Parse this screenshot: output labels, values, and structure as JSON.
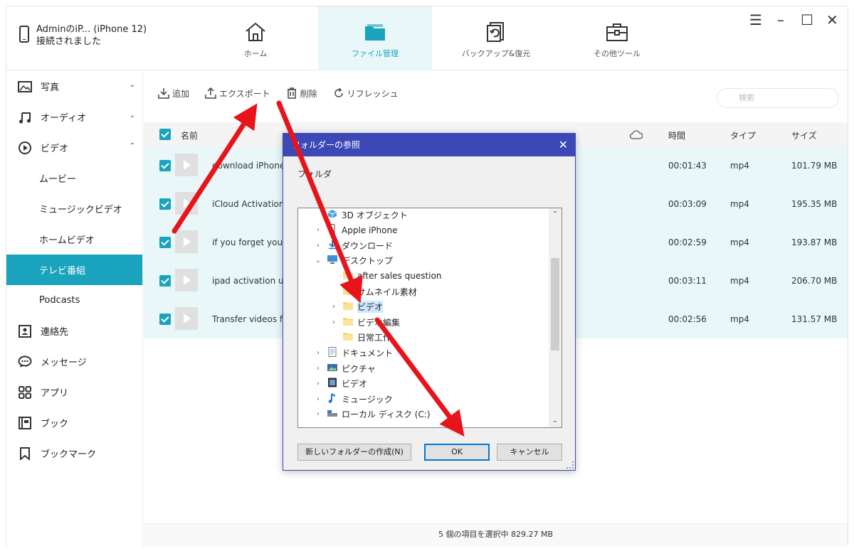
{
  "device": {
    "name": "AdminのiP... (iPhone 12)",
    "status": "接続されました"
  },
  "nav": [
    {
      "label": "ホーム",
      "icon": "home-icon"
    },
    {
      "label": "ファイル管理",
      "icon": "folder-icon",
      "active": true
    },
    {
      "label": "バックアップ&復元",
      "icon": "backup-restore-icon"
    },
    {
      "label": "その他ツール",
      "icon": "toolbox-icon"
    }
  ],
  "window_controls": {
    "menu": "☰",
    "minimize": "–",
    "maximize": "☐",
    "close": "✕"
  },
  "sidebar": {
    "photos": "写真",
    "audio": "オーディオ",
    "video": "ビデオ",
    "video_sub": [
      "ムービー",
      "ミュージックビデオ",
      "ホームビデオ",
      "テレビ番組",
      "Podcasts"
    ],
    "contacts": "連絡先",
    "messages": "メッセージ",
    "apps": "アプリ",
    "books": "ブック",
    "bookmarks": "ブックマーク"
  },
  "toolbar": {
    "add": "追加",
    "export": "エクスポート",
    "delete": "削除",
    "refresh": "リフレッシュ",
    "search_placeholder": "検索"
  },
  "table": {
    "headers": {
      "name": "名前",
      "time": "時間",
      "type": "タイプ",
      "size": "サイズ"
    },
    "rows": [
      {
        "name": "download iPhone",
        "time": "00:01:43",
        "type": "mp4",
        "size": "101.79 MB"
      },
      {
        "name": "iCloud Activation",
        "time": "00:03:09",
        "type": "mp4",
        "size": "195.35 MB"
      },
      {
        "name": "if you forget your",
        "time": "00:02:59",
        "type": "mp4",
        "size": "193.87 MB"
      },
      {
        "name": "ipad activation ur",
        "time": "00:03:11",
        "type": "mp4",
        "size": "206.70 MB"
      },
      {
        "name": "Transfer videos fr",
        "time": "00:02:56",
        "type": "mp4",
        "size": "131.57 MB"
      }
    ]
  },
  "status": "5 個の項目を選択中 829.27 MB",
  "dialog": {
    "title": "フォルダーの参照",
    "label": "フォルダ",
    "tree": [
      {
        "label": "3D オブジェクト",
        "icon": "3d-objects-icon",
        "expander": "",
        "indent": 1
      },
      {
        "label": "Apple iPhone",
        "icon": "phone-icon",
        "expander": "›",
        "indent": 1
      },
      {
        "label": "ダウンロード",
        "icon": "download-folder-icon",
        "expander": "›",
        "indent": 1
      },
      {
        "label": "デスクトップ",
        "icon": "desktop-icon",
        "expander": "⌄",
        "indent": 1
      },
      {
        "label": "after sales question",
        "icon": "folder-icon",
        "expander": "",
        "indent": 2
      },
      {
        "label": "サムネイル素材",
        "icon": "folder-icon",
        "expander": "",
        "indent": 2
      },
      {
        "label": "ビデオ",
        "icon": "folder-icon",
        "expander": "›",
        "indent": 2,
        "selected": true
      },
      {
        "label": "ビデオ編集",
        "icon": "folder-icon",
        "expander": "›",
        "indent": 2
      },
      {
        "label": "日常工作",
        "icon": "folder-icon",
        "expander": "",
        "indent": 2
      },
      {
        "label": "ドキュメント",
        "icon": "documents-icon",
        "expander": "›",
        "indent": 1
      },
      {
        "label": "ピクチャ",
        "icon": "pictures-icon",
        "expander": "›",
        "indent": 1
      },
      {
        "label": "ビデオ",
        "icon": "videos-icon",
        "expander": "›",
        "indent": 1
      },
      {
        "label": "ミュージック",
        "icon": "music-icon",
        "expander": "›",
        "indent": 1
      },
      {
        "label": "ローカル ディスク (C:)",
        "icon": "drive-icon",
        "expander": "›",
        "indent": 1
      }
    ],
    "buttons": {
      "new_folder": "新しいフォルダーの作成(N)",
      "ok": "OK",
      "cancel": "キャンセル"
    }
  },
  "colors": {
    "accent": "#1aa3bd",
    "dialog_title": "#3b48b5",
    "arrow": "#e8141b",
    "row_bg": "#e9f7f9"
  }
}
